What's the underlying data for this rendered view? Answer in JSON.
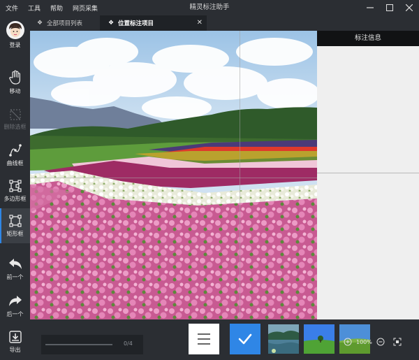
{
  "menu": {
    "file": "文件",
    "tools": "工具",
    "help": "帮助",
    "web_collect": "网页采集"
  },
  "app_title": "精灵标注助手",
  "sidebar": {
    "login": "登录",
    "move": "移动",
    "delete_box": "删除选框",
    "curve_box": "曲线框",
    "polygon_box": "多边形框",
    "rect_box": "矩形框",
    "prev": "前一个",
    "next": "后一个",
    "export": "导出"
  },
  "tabs": {
    "all_projects": "全部项目列表",
    "location_project": "位置标注项目",
    "close": "✕"
  },
  "right_panel": {
    "title": "标注信息"
  },
  "progress": {
    "text": "0/4",
    "fraction": 0
  },
  "zoom": {
    "percent": "100%"
  },
  "icons": [
    "avatar-icon",
    "hand-icon",
    "delete-box-icon",
    "curve-icon",
    "polygon-icon",
    "rect-icon",
    "undo-arrow-icon",
    "redo-arrow-icon",
    "export-icon",
    "list-icon",
    "check-icon",
    "zoom-in-icon",
    "zoom-out-icon",
    "fit-icon"
  ],
  "colors": {
    "accent": "#2f86e6",
    "panel_bg": "#2b2e33",
    "right_panel": "#efefef"
  }
}
